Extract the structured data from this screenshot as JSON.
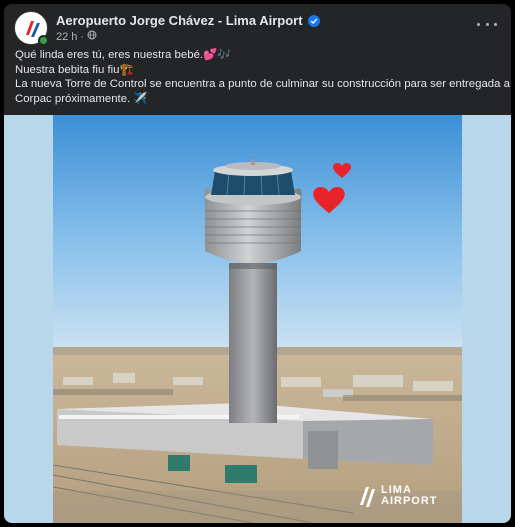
{
  "post": {
    "page_name": "Aeropuerto Jorge Chávez - Lima Airport",
    "time": "22 h",
    "separator": "·",
    "icons": {
      "verified": "verified-badge-icon",
      "audience": "globe-icon",
      "more": "more-options-icon",
      "avatar": "lima-airport-logo"
    },
    "text_lines": [
      "Qué linda eres tú, eres nuestra bebé.💕🎶",
      "Nuestra bebita fiu fiu🏗️",
      "La nueva Torre de Control se encuentra a punto de culminar su construcción para ser entregada a",
      "Corpac próximamente. ✈️"
    ],
    "image": {
      "watermark_line1": "LIMA",
      "watermark_line2": "AIRPORT",
      "hearts": "heart-icons"
    }
  },
  "colors": {
    "card_bg": "#242526",
    "media_side_bg": "#b8d7ea",
    "verified": "#1877f2",
    "heart": "#e8242b"
  }
}
